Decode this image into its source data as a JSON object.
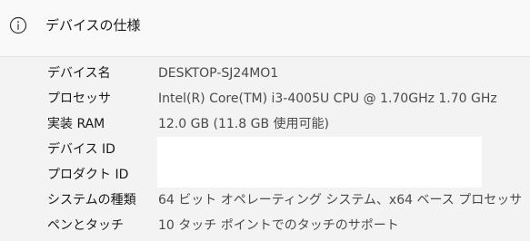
{
  "header": {
    "title": "デバイスの仕様",
    "icon": "info-icon"
  },
  "specs": [
    {
      "label": "デバイス名",
      "value": "DESKTOP-SJ24MO1",
      "redacted": false
    },
    {
      "label": "プロセッサ",
      "value": "Intel(R) Core(TM) i3-4005U CPU @ 1.70GHz   1.70 GHz",
      "redacted": false
    },
    {
      "label": "実装 RAM",
      "value": "12.0 GB (11.8 GB 使用可能)",
      "redacted": false
    },
    {
      "label": "デバイス ID",
      "value": "",
      "redacted": true
    },
    {
      "label": "プロダクト ID",
      "value": "",
      "redacted": true
    },
    {
      "label": "システムの種類",
      "value": "64 ビット オペレーティング システム、x64 ベース プロセッサ",
      "redacted": false
    },
    {
      "label": "ペンとタッチ",
      "value": "10 タッチ ポイントでのタッチのサポート",
      "redacted": false
    }
  ]
}
